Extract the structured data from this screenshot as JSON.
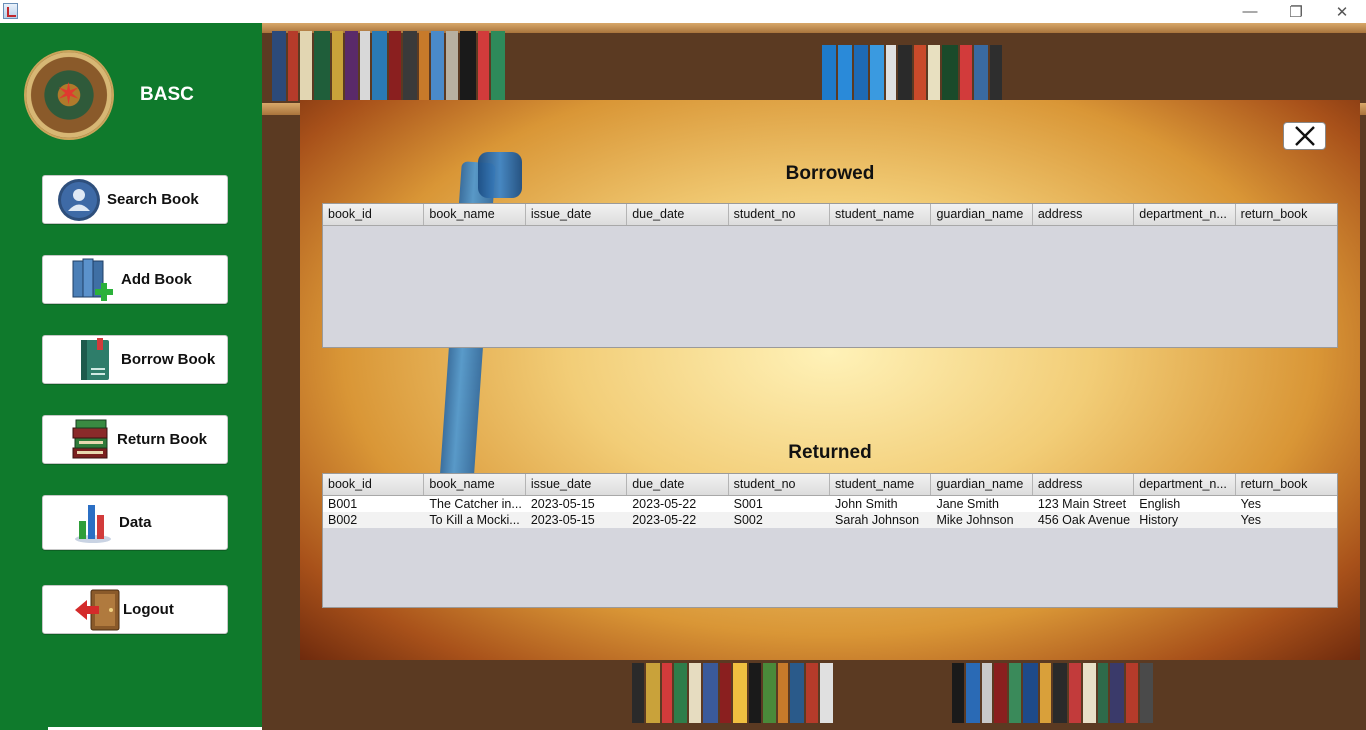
{
  "window": {
    "minimize_glyph": "—",
    "maximize_glyph": "❐",
    "close_glyph": "✕"
  },
  "sidebar": {
    "brand": "BASC",
    "buttons": [
      {
        "label": "Search Book",
        "icon": "user-search-icon"
      },
      {
        "label": "Add Book",
        "icon": "add-book-icon"
      },
      {
        "label": "Borrow Book",
        "icon": "borrow-book-icon"
      },
      {
        "label": "Return Book",
        "icon": "return-book-icon"
      },
      {
        "label": "Data",
        "icon": "bar-chart-icon"
      },
      {
        "label": "Logout",
        "icon": "logout-door-icon"
      }
    ],
    "colors": {
      "background": "#0f7a2c",
      "button": "#ffffff"
    }
  },
  "main": {
    "borrowed": {
      "title": "Borrowed",
      "columns": [
        "book_id",
        "book_name",
        "issue_date",
        "due_date",
        "student_no",
        "student_name",
        "guardian_name",
        "address",
        "department_n...",
        "return_book"
      ],
      "rows": []
    },
    "returned": {
      "title": "Returned",
      "columns": [
        "book_id",
        "book_name",
        "issue_date",
        "due_date",
        "student_no",
        "student_name",
        "guardian_name",
        "address",
        "department_n...",
        "return_book"
      ],
      "rows": [
        [
          "B001",
          "The Catcher in...",
          "2023-05-15",
          "2023-05-22",
          "S001",
          "John Smith",
          "Jane Smith",
          "123 Main Street",
          "English",
          "Yes"
        ],
        [
          "B002",
          "To Kill a Mocki...",
          "2023-05-15",
          "2023-05-22",
          "S002",
          "Sarah Johnson",
          "Mike Johnson",
          "456 Oak Avenue",
          "History",
          "Yes"
        ]
      ]
    },
    "close_icon": "close-x-icon"
  }
}
